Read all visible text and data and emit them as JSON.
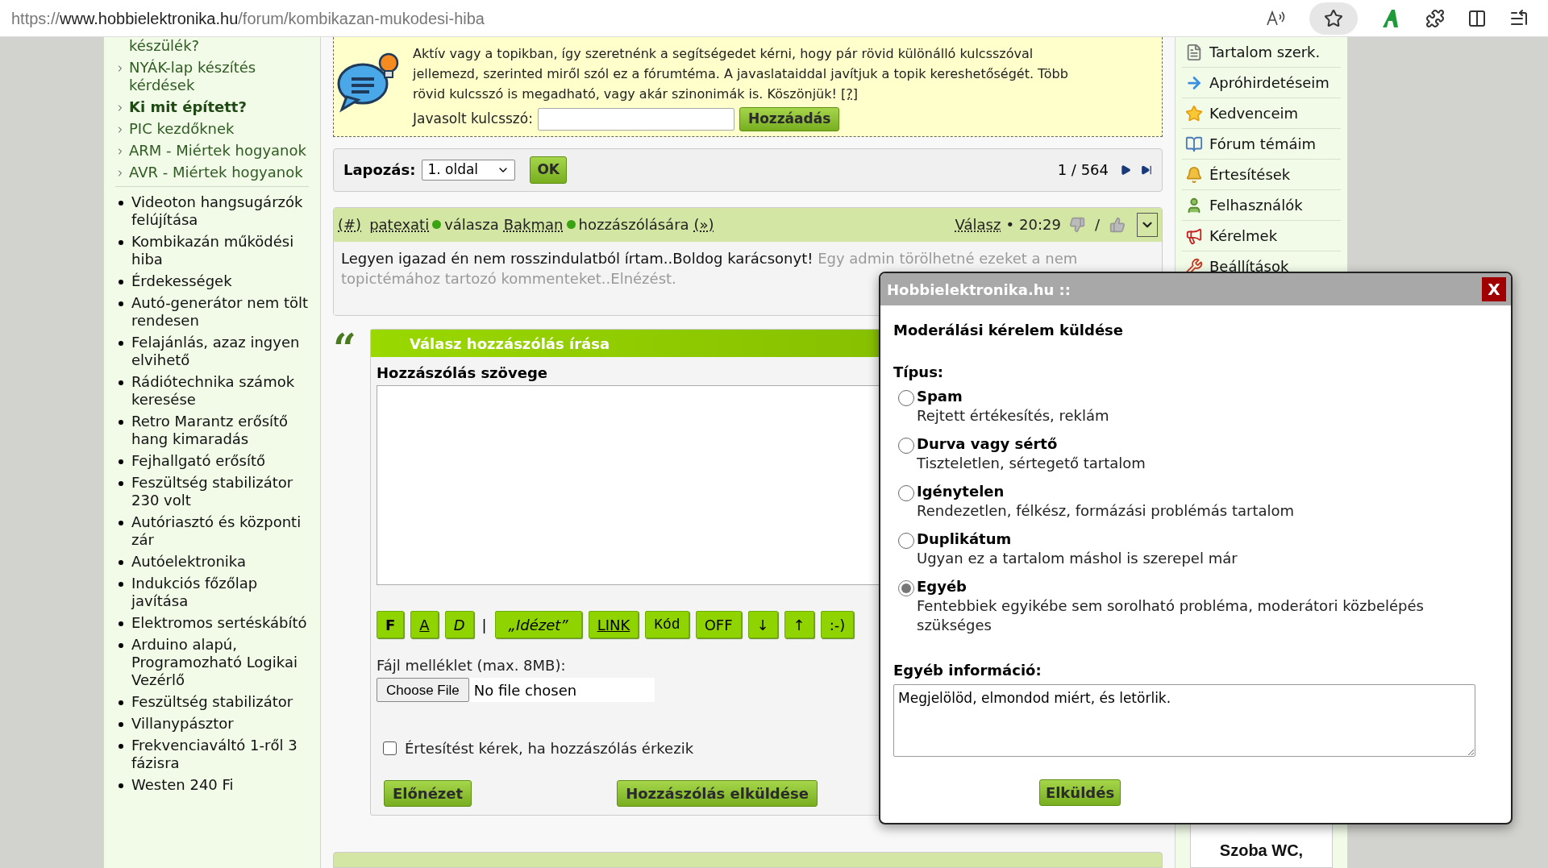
{
  "browser": {
    "url_scheme": "https://",
    "url_host": "www.hobbielektronika.hu",
    "url_path": "/forum/kombikazan-mukodesi-hiba"
  },
  "left_sidebar": {
    "subtopics": [
      {
        "text": "készülék?",
        "selected": false,
        "kind": "continuation"
      },
      {
        "text": "NYÁK-lap készítés kérdések",
        "selected": false,
        "kind": "item"
      },
      {
        "text": "Ki mit épített?",
        "selected": true,
        "kind": "item"
      },
      {
        "text": "PIC kezdőknek",
        "selected": false,
        "kind": "item"
      },
      {
        "text": "ARM - Miértek hogyanok",
        "selected": false,
        "kind": "item"
      },
      {
        "text": "AVR - Miértek hogyanok",
        "selected": false,
        "kind": "item"
      }
    ],
    "topics": [
      "Videoton hangsugárzók felújítása",
      "Kombikazán működési hiba",
      "Érdekességek",
      "Autó-generátor nem tölt rendesen",
      "Felajánlás, azaz ingyen elvihető",
      "Rádiótechnika számok keresése",
      "Retro Marantz erősítő hang kimaradás",
      "Fejhallgató erősítő",
      "Feszültség stabilizátor 230 volt",
      "Autóriasztó és központi zár",
      "Autóelektronika",
      "Indukciós főzőlap javítása",
      "Elektromos sertéskábító",
      "Arduino alapú, Programozható Logikai Vezérlő",
      "Feszültség stabilizátor",
      "Villanypásztor",
      "Frekvenciaváltó 1-ről 3 fázisra",
      "Westen 240 Fi"
    ]
  },
  "keyword_box": {
    "message": "Aktív vagy a topikban, így szeretnénk a segítségedet kérni, hogy pár rövid különálló kulcsszóval jellemezd, szerinted miről szól ez a fórumtéma. A javaslataiddal javítjuk a topik kereshetőségét. Több rövid kulcsszó is megadható, vagy akár szinonimák is. Köszönjük!",
    "help_link": "[?]",
    "label": "Javasolt kulcsszó:",
    "button": "Hozzáadás"
  },
  "pagination": {
    "label": "Lapozás:",
    "select": "1. oldal",
    "ok": "OK",
    "counter": "1 / 564"
  },
  "post": {
    "number_link": "(#)",
    "author": {
      "name": "patexati",
      "online": true
    },
    "verb": "válasza",
    "target": {
      "name": "Bakman",
      "online": true
    },
    "suffix": "hozzászólására",
    "jump_link": "(»)",
    "reply_link": "Válasz",
    "separator": "•",
    "time": "20:29",
    "vote_separator": "/",
    "text": "Legyen igazad én nem rosszindulatból írtam..Boldog karácsonyt!",
    "muted_text": "Egy admin törölhetné ezeket a nem topictémához tartozó kommenteket..Elnézést."
  },
  "reply_form": {
    "quote_mark": "“",
    "title": "Válasz hozzászólás írása",
    "body_label": "Hozzászólás szövege",
    "toolbar": [
      {
        "label": "F",
        "kind": "bold"
      },
      {
        "label": "A",
        "kind": "underline"
      },
      {
        "label": "D",
        "kind": "italic"
      },
      {
        "label": "|",
        "kind": "separator"
      },
      {
        "label": "„Idézet”",
        "kind": "quote"
      },
      {
        "label": "LINK",
        "kind": "link"
      },
      {
        "label": "Kód",
        "kind": "code"
      },
      {
        "label": "OFF",
        "kind": "plain"
      },
      {
        "label": "↓",
        "kind": "plain"
      },
      {
        "label": "↑",
        "kind": "plain"
      },
      {
        "label": ":-)",
        "kind": "plain"
      }
    ],
    "attachment_label": "Fájl melléklet (max. 8MB):",
    "file_button": "Choose File",
    "file_status": "No file chosen",
    "notify": {
      "label": "Értesítést kérek, ha hozzászólás érkezik",
      "checked": false
    },
    "preview_button": "Előnézet",
    "submit_button": "Hozzászólás elküldése"
  },
  "right_sidebar": {
    "items": [
      "Tartalom szerk.",
      "Apróhirdetéseim",
      "Kedvenceim",
      "Fórum témáim",
      "Értesítések",
      "Felhasználók",
      "Kérelmek",
      "Beállítások"
    ],
    "card_title": "Szoba WC,"
  },
  "dialog": {
    "title": "Hobbielektronika.hu ::",
    "close": "X",
    "heading": "Moderálási kérelem küldése",
    "type_label": "Típus:",
    "options": [
      {
        "label": "Spam",
        "description": "Rejtett értékesítés, reklám",
        "selected": false
      },
      {
        "label": "Durva vagy sértő",
        "description": "Tiszteletlen, sértegető tartalom",
        "selected": false
      },
      {
        "label": "Igénytelen",
        "description": "Rendezetlen, félkész, formázási problémás tartalom",
        "selected": false
      },
      {
        "label": "Duplikátum",
        "description": "Ugyan ez a tartalom máshol is szerepel már",
        "selected": false
      },
      {
        "label": "Egyéb",
        "description": "Fentebbiek egyikébe sem sorolható probléma, moderátori közbelépés szükséges",
        "selected": true
      }
    ],
    "info_label": "Egyéb információ:",
    "info_value": "Megjelölöd, elmondod miért, és letörlik.",
    "submit": "Elküldés"
  }
}
